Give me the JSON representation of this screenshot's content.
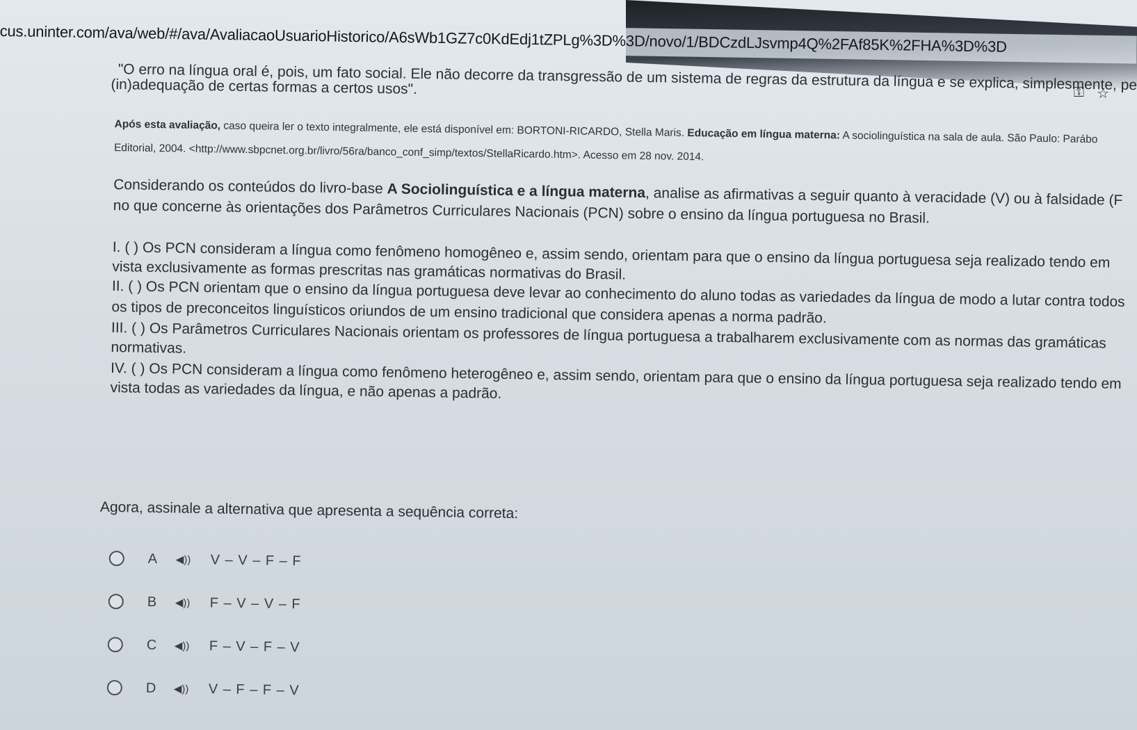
{
  "browser": {
    "url": "cus.uninter.com/ava/web/#/ava/AvaliacaoUsuarioHistorico/A6sWb1GZ7c0KdEdj1tZPLg%3D%3D/novo/1/BDCzdLJsvmp4Q%2FAf85K%2FHA%3D%3D",
    "icons": [
      "key-icon",
      "star-icon"
    ]
  },
  "question": {
    "quote_line1": "\"O erro na língua oral é, pois, um fato social. Ele não decorre da transgressão de um sistema de regras da estrutura da língua e se explica, simplesmente, pe",
    "quote_line2": "(in)adequação de certas formas a certos usos\".",
    "note_bold": "Após esta avaliação,",
    "note_rest": " caso queira ler o texto integralmente, ele está disponível em:  BORTONI-RICARDO, Stella Maris. ",
    "note_book_bold": "Educação em língua materna:",
    "note_book_rest": " A sociolinguística na sala de aula. São Paulo: Parábo",
    "note_line2": "Editorial, 2004. <http://www.sbpcnet.org.br/livro/56ra/banco_conf_simp/textos/StellaRicardo.htm>. Acesso em 28 nov. 2014.",
    "intro_line1_start": "Considerando os conteúdos do livro-base ",
    "intro_book": "A Sociolinguística e a língua materna",
    "intro_line1_end": ", analise as afirmativas a seguir quanto à veracidade (V) ou à falsidade (F",
    "intro_line2": "no que concerne às orientações dos Parâmetros Curriculares Nacionais (PCN) sobre o ensino da língua portuguesa no Brasil.",
    "statements": [
      {
        "line1": "I. (    ) Os PCN consideram a língua como fenômeno homogêneo e, assim sendo, orientam para que o ensino da língua portuguesa seja realizado tendo em",
        "line2": "vista exclusivamente as formas prescritas nas gramáticas normativas do Brasil."
      },
      {
        "line1": "II. (  ) Os PCN orientam que o ensino da língua portuguesa deve levar ao conhecimento do aluno todas as variedades da língua de modo a lutar contra todos",
        "line2": "os tipos de preconceitos linguísticos oriundos de um ensino tradicional que considera apenas a norma padrão."
      },
      {
        "line1": "III. (  ) Os Parâmetros Curriculares Nacionais orientam os professores de língua portuguesa a trabalharem exclusivamente com as normas das gramáticas",
        "line2": "normativas."
      },
      {
        "line1": "IV. (  ) Os PCN consideram a língua como fenômeno heterogêneo e, assim sendo, orientam para que o ensino da língua portuguesa seja realizado tendo em",
        "line2": "vista todas as variedades da língua, e não apenas a padrão."
      }
    ],
    "prompt": "Agora, assinale a alternativa que apresenta a sequência correta:",
    "options": [
      {
        "letter": "A",
        "text": "V – V – F – F",
        "icon": "speaker-icon"
      },
      {
        "letter": "B",
        "text": "F – V – V – F",
        "icon": "speaker-icon"
      },
      {
        "letter": "C",
        "text": "F – V – F – V",
        "icon": "speaker-icon"
      },
      {
        "letter": "D",
        "text": "V – F – F – V",
        "icon": "speaker-icon"
      }
    ]
  }
}
